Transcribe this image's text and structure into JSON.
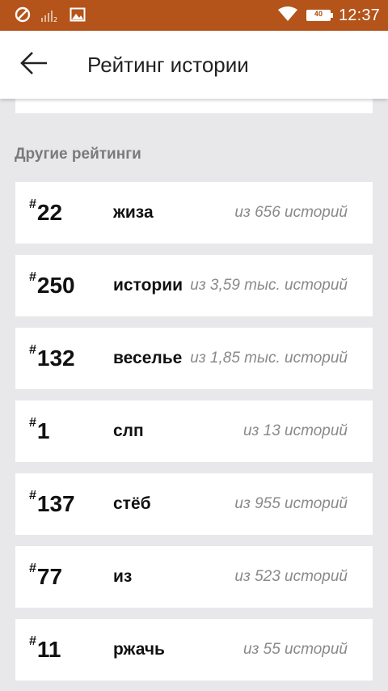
{
  "status_bar": {
    "time": "12:37",
    "battery": "40"
  },
  "app_bar": {
    "title": "Рейтинг истории"
  },
  "section": {
    "title": "Другие рейтинги"
  },
  "ratings": [
    {
      "rank": "22",
      "tag": "жиза",
      "count": "из 656 историй"
    },
    {
      "rank": "250",
      "tag": "истории",
      "count": "из 3,59 тыс. историй"
    },
    {
      "rank": "132",
      "tag": "веселье",
      "count": "из 1,85 тыс. историй"
    },
    {
      "rank": "1",
      "tag": "слп",
      "count": "из 13 историй"
    },
    {
      "rank": "137",
      "tag": "стёб",
      "count": "из 955 историй"
    },
    {
      "rank": "77",
      "tag": "из",
      "count": "из 523 историй"
    },
    {
      "rank": "11",
      "tag": "ржачь",
      "count": "из 55 историй"
    }
  ]
}
